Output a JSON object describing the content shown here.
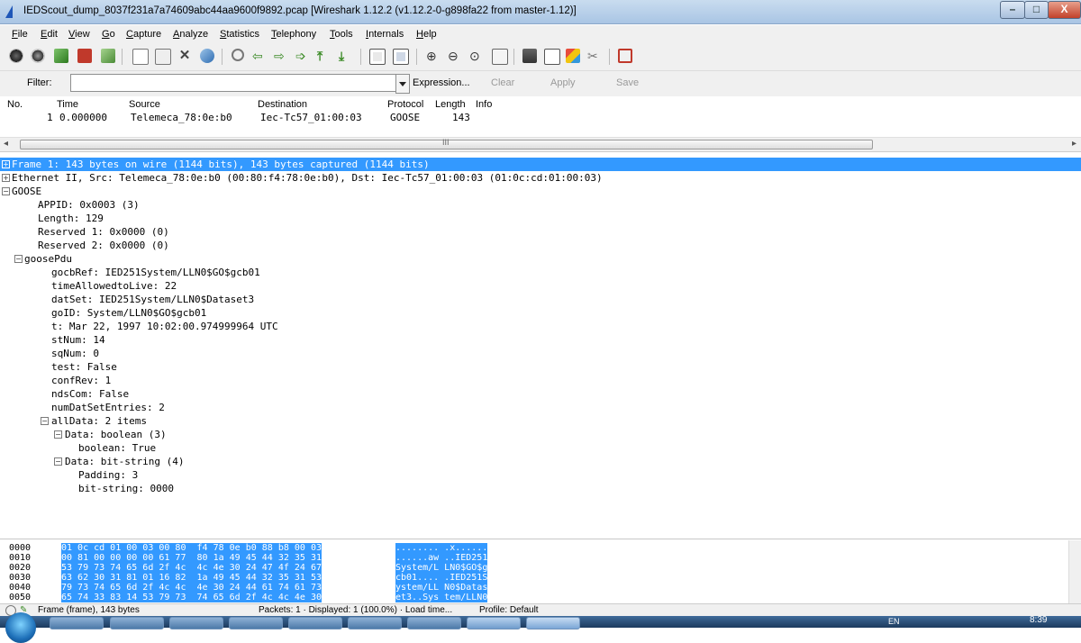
{
  "window": {
    "title": "IEDScout_dump_8037f231a7a74609abc44aa9600f9892.pcap   [Wireshark 1.12.2  (v1.12.2-0-g898fa22 from master-1.12)]",
    "minimize_label": "–",
    "maximize_label": "□",
    "close_label": "X"
  },
  "menu": [
    "File",
    "Edit",
    "View",
    "Go",
    "Capture",
    "Analyze",
    "Statistics",
    "Telephony",
    "Tools",
    "Internals",
    "Help"
  ],
  "toolbar_icons": [
    "interface-list-icon",
    "capture-options-icon",
    "start-capture-icon",
    "stop-capture-icon",
    "restart-capture-icon",
    "open-file-icon",
    "save-file-icon",
    "close-file-icon",
    "reload-icon",
    "find-packet-icon",
    "go-back-icon",
    "go-forward-icon",
    "go-to-packet-icon",
    "go-first-icon",
    "go-last-icon",
    "colorize-icon",
    "auto-scroll-icon",
    "zoom-in-icon",
    "zoom-out-icon",
    "normal-size-icon",
    "resize-columns-icon",
    "capture-filters-icon",
    "display-filters-icon",
    "coloring-rules-icon",
    "preferences-icon",
    "help-icon"
  ],
  "filter": {
    "label": "Filter:",
    "value": "",
    "expression": "Expression...",
    "clear": "Clear",
    "apply": "Apply",
    "save": "Save"
  },
  "packet_list": {
    "headers": {
      "no": "No.",
      "time": "Time",
      "source": "Source",
      "destination": "Destination",
      "protocol": "Protocol",
      "length": "Length",
      "info": "Info"
    },
    "rows": [
      {
        "no": "1",
        "time": "0.000000",
        "source": "Telemeca_78:0e:b0",
        "destination": "Iec-Tc57_01:00:03",
        "protocol": "GOOSE",
        "length": "143",
        "info": ""
      }
    ],
    "scroll_grip": "III"
  },
  "details": [
    {
      "text": "Frame 1: 143 bytes on wire (1144 bits), 143 bytes captured (1144 bits)",
      "exp": "+"
    },
    {
      "text": "Ethernet II, Src: Telemeca_78:0e:b0 (00:80:f4:78:0e:b0), Dst: Iec-Tc57_01:00:03 (01:0c:cd:01:00:03)",
      "exp": "+"
    },
    {
      "text": "GOOSE",
      "exp": "-"
    },
    {
      "text": "APPID: 0x0003 (3)",
      "exp": ""
    },
    {
      "text": "Length: 129",
      "exp": ""
    },
    {
      "text": "Reserved 1: 0x0000 (0)",
      "exp": ""
    },
    {
      "text": "Reserved 2: 0x0000 (0)",
      "exp": ""
    },
    {
      "text": "goosePdu",
      "exp": "-"
    },
    {
      "text": "gocbRef: IED251System/LLN0$GO$gcb01",
      "exp": ""
    },
    {
      "text": "timeAllowedtoLive: 22",
      "exp": ""
    },
    {
      "text": "datSet: IED251System/LLN0$Dataset3",
      "exp": ""
    },
    {
      "text": "goID: System/LLN0$GO$gcb01",
      "exp": ""
    },
    {
      "text": "t: Mar 22, 1997 10:02:00.974999964 UTC",
      "exp": ""
    },
    {
      "text": "stNum: 14",
      "exp": ""
    },
    {
      "text": "sqNum: 0",
      "exp": ""
    },
    {
      "text": "test: False",
      "exp": ""
    },
    {
      "text": "confRev: 1",
      "exp": ""
    },
    {
      "text": "ndsCom: False",
      "exp": ""
    },
    {
      "text": "numDatSetEntries: 2",
      "exp": ""
    },
    {
      "text": "allData: 2 items",
      "exp": "-"
    },
    {
      "text": "Data: boolean (3)",
      "exp": "-"
    },
    {
      "text": "boolean: True",
      "exp": ""
    },
    {
      "text": "Data: bit-string (4)",
      "exp": "-"
    },
    {
      "text": "Padding: 3",
      "exp": ""
    },
    {
      "text": "bit-string: 0000",
      "exp": ""
    }
  ],
  "bytes": [
    {
      "offset": "0000",
      "hex": "01 0c cd 01 00 03 00 80  f4 78 0e b0 88 b8 00 03",
      "ascii": "........ .x......"
    },
    {
      "offset": "0010",
      "hex": "00 81 00 00 00 00 61 77  80 1a 49 45 44 32 35 31",
      "ascii": "......aw ..IED251"
    },
    {
      "offset": "0020",
      "hex": "53 79 73 74 65 6d 2f 4c  4c 4e 30 24 47 4f 24 67",
      "ascii": "System/L LN0$GO$g"
    },
    {
      "offset": "0030",
      "hex": "63 62 30 31 81 01 16 82  1a 49 45 44 32 35 31 53",
      "ascii": "cb01.... .IED251S"
    },
    {
      "offset": "0040",
      "hex": "79 73 74 65 6d 2f 4c 4c  4e 30 24 44 61 74 61 73",
      "ascii": "ystem/LL N0$Datas"
    },
    {
      "offset": "0050",
      "hex": "65 74 33 83 14 53 79 73  74 65 6d 2f 4c 4c 4e 30",
      "ascii": "et3..Sys tem/LLN0"
    }
  ],
  "status": {
    "frame": "Frame (frame), 143 bytes",
    "packets": "Packets: 1 · Displayed: 1 (100.0%) · Load time...",
    "profile": "Profile: Default"
  },
  "taskbar": {
    "lang": "EN",
    "time": "8:39"
  }
}
